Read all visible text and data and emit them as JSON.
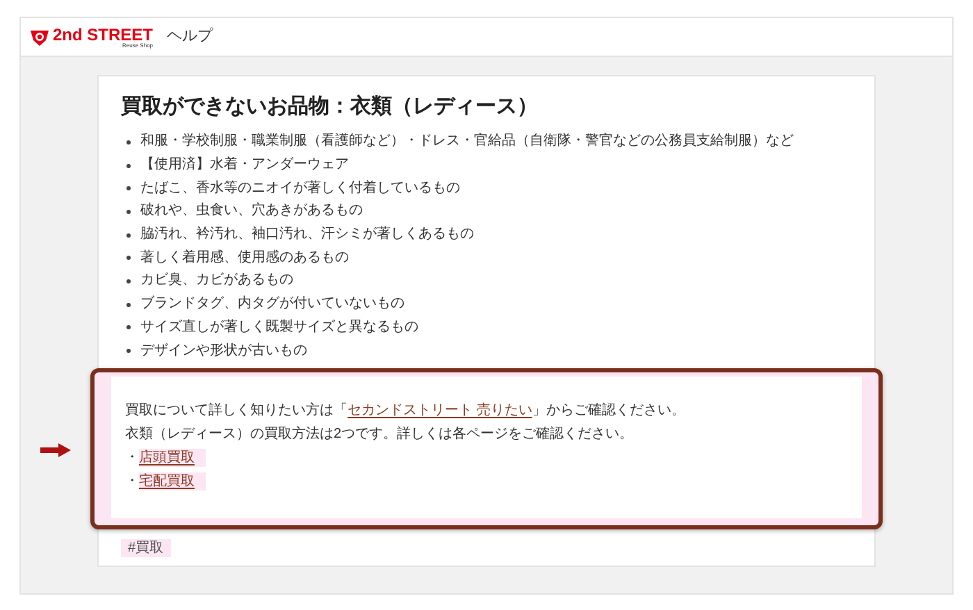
{
  "header": {
    "logo_text": "2nd STREET",
    "logo_subtext": "Reuse Shop",
    "title": "ヘルプ"
  },
  "article": {
    "title": "買取ができないお品物：衣類（レディース）",
    "items": [
      "和服・学校制服・職業制服（看護師など）・ドレス・官給品（自衛隊・警官などの公務員支給制服）など",
      "【使用済】水着・アンダーウェア",
      "たばこ、香水等のニオイが著しく付着しているもの",
      "破れや、虫食い、穴あきがあるもの",
      "脇汚れ、衿汚れ、袖口汚れ、汗シミが著しくあるもの",
      "著しく着用感、使用感のあるもの",
      "カビ臭、カビがあるもの",
      "ブランドタグ、内タグが付いていないもの",
      "サイズ直しが著しく既製サイズと異なるもの",
      "デザインや形状が古いもの"
    ],
    "notice": {
      "lines": [
        {
          "kind": "sentence",
          "before": "買取について詳しく知りたい方は「",
          "link": "セカンドストリート 売りたい",
          "after": "」からご確認ください。"
        },
        {
          "kind": "sentence",
          "before": "衣類（レディース）の買取方法は2つです。詳しくは各ページをご確認ください。"
        },
        {
          "kind": "link_item",
          "bullet": "・",
          "link": "店頭買取"
        },
        {
          "kind": "link_item",
          "bullet": "・",
          "link": "宅配買取"
        }
      ]
    },
    "tags": [
      "#買取"
    ]
  }
}
